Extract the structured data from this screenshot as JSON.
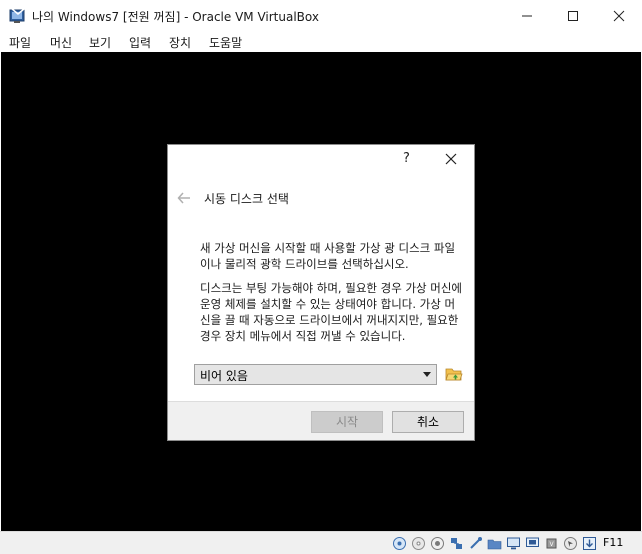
{
  "window": {
    "title": "나의 Windows7 [전원 꺼짐] - Oracle VM VirtualBox"
  },
  "menubar": {
    "items": [
      "파일",
      "머신",
      "보기",
      "입력",
      "장치",
      "도움말"
    ]
  },
  "dialog": {
    "help_label": "?",
    "heading": "시동 디스크 선택",
    "paragraph1": "새 가상 머신을 시작할 때 사용할 가상 광 디스크 파일이나 물리적 광학 드라이브를 선택하십시오.",
    "paragraph2": "디스크는 부팅 가능해야 하며, 필요한 경우 가상 머신에 운영 체제를 설치할 수 있는 상태여야 합니다. 가상 머신을 끌 때 자동으로 드라이브에서 꺼내지지만, 필요한 경우 장치 메뉴에서 직접 꺼낼 수 있습니다.",
    "disk_select_value": "비어 있음",
    "start_label": "시작",
    "cancel_label": "취소"
  },
  "statusbar": {
    "host_key": "F11",
    "icons": [
      "hard-disk-icon",
      "optical-disk-icon",
      "audio-icon",
      "network-icon",
      "usb-icon",
      "shared-folder-icon",
      "display-icon",
      "video-capture-icon",
      "cpu-icon",
      "mouse-integration-icon",
      "host-key-arrow-icon"
    ]
  },
  "colors": {
    "vm_background": "#000000",
    "dialog_footer": "#f0f0f0",
    "disabled_text": "#8a8a8a"
  }
}
